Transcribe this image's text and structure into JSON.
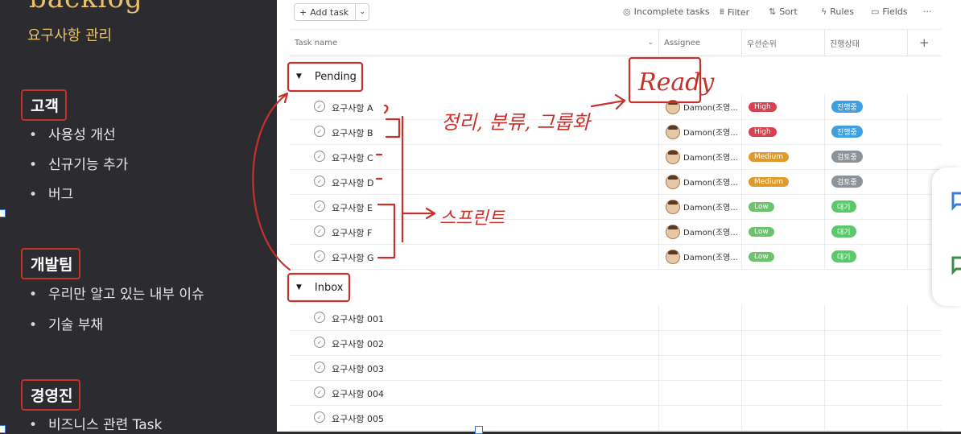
{
  "slide": {
    "title": "backlog",
    "subtitle": "요구사항 관리",
    "groups": [
      {
        "title": "고객",
        "items": [
          "사용성 개선",
          "신규기능 추가",
          "버그"
        ]
      },
      {
        "title": "개발팀",
        "items": [
          "우리만 알고 있는 내부 이슈",
          "기술 부채"
        ]
      },
      {
        "title": "경영진",
        "items": [
          "비즈니스 관련 Task"
        ]
      }
    ]
  },
  "toolbar": {
    "add_task": "Add task",
    "incomplete": "Incomplete tasks",
    "filter": "Filter",
    "sort": "Sort",
    "rules": "Rules",
    "fields": "Fields",
    "more": "···"
  },
  "columns": {
    "task_name": "Task name",
    "assignee": "Assignee",
    "priority": "우선순위",
    "status": "진행상태",
    "add": "+"
  },
  "sections": [
    {
      "name": "Pending",
      "tasks": [
        {
          "name": "요구사항 A",
          "assignee": "Damon(조영...",
          "priority": "High",
          "status": "진행중"
        },
        {
          "name": "요구사항 B",
          "assignee": "Damon(조영...",
          "priority": "High",
          "status": "진행중"
        },
        {
          "name": "요구사항 C",
          "assignee": "Damon(조영...",
          "priority": "Medium",
          "status": "검토중"
        },
        {
          "name": "요구사항 D",
          "assignee": "Damon(조영...",
          "priority": "Medium",
          "status": "검토중"
        },
        {
          "name": "요구사항 E",
          "assignee": "Damon(조영...",
          "priority": "Low",
          "status": "대기"
        },
        {
          "name": "요구사항 F",
          "assignee": "Damon(조영...",
          "priority": "Low",
          "status": "대기"
        },
        {
          "name": "요구사항 G",
          "assignee": "Damon(조영...",
          "priority": "Low",
          "status": "대기"
        }
      ]
    },
    {
      "name": "Inbox",
      "tasks": [
        {
          "name": "요구사항 001"
        },
        {
          "name": "요구사항 002"
        },
        {
          "name": "요구사항 003"
        },
        {
          "name": "요구사항 004"
        },
        {
          "name": "요구사항 005"
        }
      ]
    }
  ],
  "annotations": {
    "ready": "Ready",
    "organize": "정리, 분류, 그룹화",
    "sprint": "스프린트"
  },
  "colors": {
    "high": "#d9414e",
    "medium": "#e09a2b",
    "low": "#6cc36c",
    "in_progress": "#3d9fe0",
    "review": "#8a9399",
    "waiting": "#5ac96b",
    "annotation_red": "#c7312b"
  }
}
